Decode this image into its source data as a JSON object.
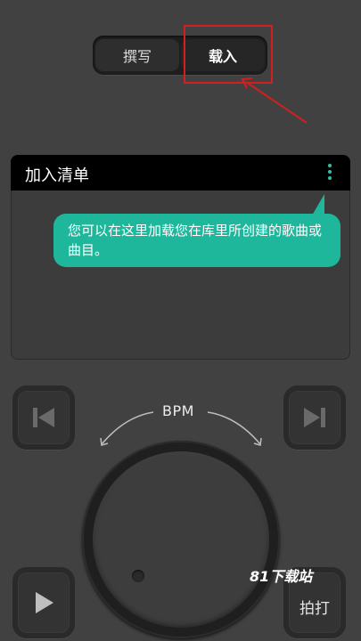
{
  "tabs": {
    "write_label": "撰写",
    "load_label": "载入"
  },
  "playlist": {
    "title": "加入清单",
    "tooltip": "您可以在这里加载您在库里所创建的歌曲或曲目。"
  },
  "metronome": {
    "bpm_label": "BPM",
    "tap_label": "拍打"
  },
  "watermark": "81下载站",
  "colors": {
    "accent": "#1fb79c",
    "annotation": "#d21f1f",
    "background": "#414141"
  },
  "icons": {
    "prev": "skip-previous-icon",
    "next": "skip-next-icon",
    "play": "play-icon",
    "menu": "more-vertical-icon"
  }
}
